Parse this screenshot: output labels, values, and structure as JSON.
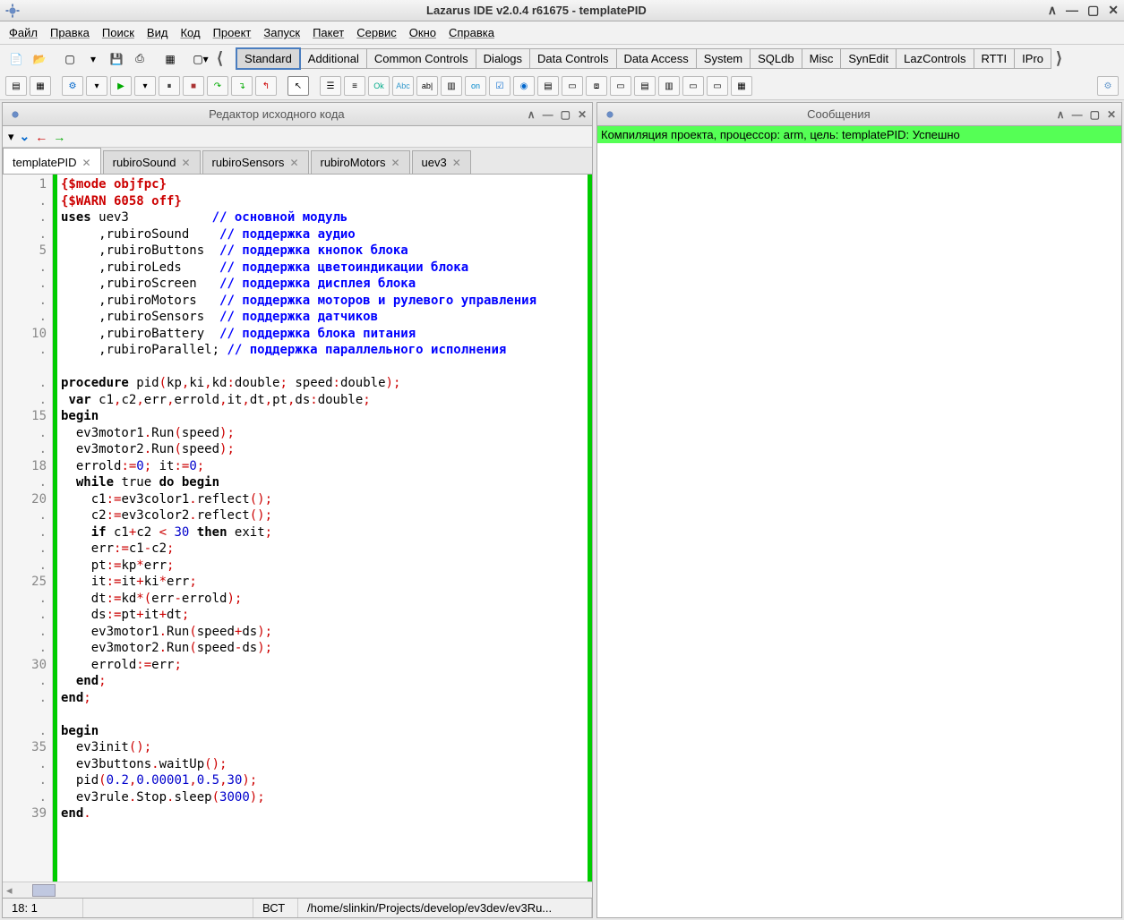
{
  "window": {
    "title": "Lazarus IDE v2.0.4 r61675 - templatePID"
  },
  "menubar": [
    "Файл",
    "Правка",
    "Поиск",
    "Вид",
    "Код",
    "Проект",
    "Запуск",
    "Пакет",
    "Сервис",
    "Окно",
    "Справка"
  ],
  "palette_tabs": [
    "Standard",
    "Additional",
    "Common Controls",
    "Dialogs",
    "Data Controls",
    "Data Access",
    "System",
    "SQLdb",
    "Misc",
    "SynEdit",
    "LazControls",
    "RTTI",
    "IPro"
  ],
  "editor": {
    "panel_title": "Редактор исходного кода",
    "tabs": [
      {
        "label": "templatePID",
        "active": true
      },
      {
        "label": "rubiroSound",
        "active": false
      },
      {
        "label": "rubiroSensors",
        "active": false
      },
      {
        "label": "rubiroMotors",
        "active": false
      },
      {
        "label": "uev3",
        "active": false
      }
    ],
    "gutter": [
      "1",
      ".",
      ".",
      ".",
      "5",
      ".",
      ".",
      ".",
      ".",
      "10",
      ".",
      "",
      ".",
      ".",
      "15",
      ".",
      ".",
      "18",
      ".",
      "20",
      ".",
      ".",
      ".",
      ".",
      "25",
      ".",
      ".",
      ".",
      ".",
      "30",
      ".",
      ".",
      "",
      ".",
      "35",
      ".",
      ".",
      ".",
      "39"
    ],
    "code": {
      "l1": "{$mode objfpc}",
      "l2": "{$WARN 6058 off}",
      "l3a": "uses",
      "l3b": " uev3           ",
      "l3c": "// основной модуль",
      "l4a": "     ,rubiroSound    ",
      "l4c": "// поддержка аудио",
      "l5a": "     ,rubiroButtons  ",
      "l5c": "// поддержка кнопок блока",
      "l6a": "     ,rubiroLeds     ",
      "l6c": "// поддержка цветоиндикации блока",
      "l7a": "     ,rubiroScreen   ",
      "l7c": "// поддержка дисплея блока",
      "l8a": "     ,rubiroMotors   ",
      "l8c": "// поддержка моторов и рулевого управления",
      "l9a": "     ,rubiroSensors  ",
      "l9c": "// поддержка датчиков",
      "l10a": "     ,rubiroBattery  ",
      "l10c": "// поддержка блока питания",
      "l11a": "     ,rubiroParallel; ",
      "l11c": "// поддержка параллельного исполнения",
      "l13": "procedure pid(kp,ki,kd:double; speed:double);",
      "l14": " var c1,c2,err,errold,it,dt,pt,ds:double;",
      "l15": "begin",
      "l16": "  ev3motor1.Run(speed);",
      "l17": "  ev3motor2.Run(speed);",
      "l18": "  errold:=0; it:=0;",
      "l19": "  while true do begin",
      "l20": "    c1:=ev3color1.reflect();",
      "l21": "    c2:=ev3color2.reflect();",
      "l22": "    if c1+c2 < 30 then exit;",
      "l23": "    err:=c1-c2;",
      "l24": "    pt:=kp*err;",
      "l25": "    it:=it+ki*err;",
      "l26": "    dt:=kd*(err-errold);",
      "l27": "    ds:=pt+it+dt;",
      "l28": "    ev3motor1.Run(speed+ds);",
      "l29": "    ev3motor2.Run(speed-ds);",
      "l30": "    errold:=err;",
      "l31": "  end;",
      "l32": "end;",
      "l34": "begin",
      "l35": "  ev3init();",
      "l36": "  ev3buttons.waitUp();",
      "l37": "  pid(0.2,0.00001,0.5,30);",
      "l38": "  ev3rule.Stop.sleep(3000);",
      "l39": "end."
    },
    "status": {
      "pos": "18: 1",
      "mode": "ВСТ",
      "path": "/home/slinkin/Projects/develop/ev3dev/ev3Ru..."
    }
  },
  "messages": {
    "panel_title": "Сообщения",
    "line": "Компиляция проекта, процессор: arm, цель: templatePID: Успешно"
  }
}
